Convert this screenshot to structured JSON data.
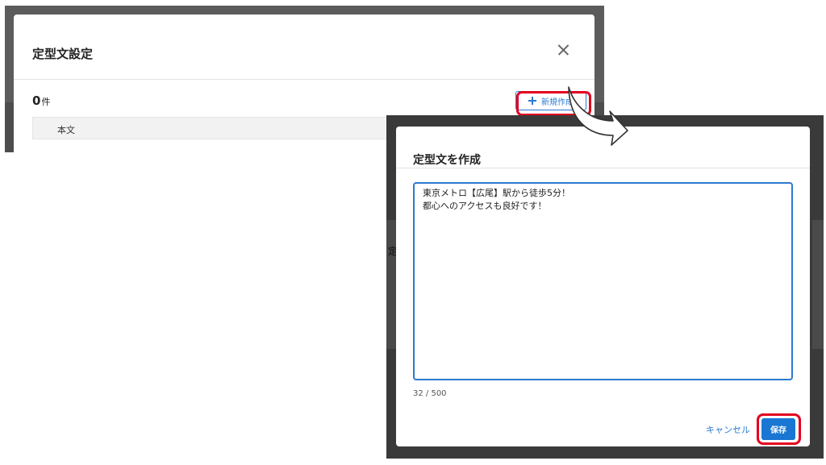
{
  "settings_dialog": {
    "title": "定型文設定",
    "count": "0",
    "count_unit": "件",
    "new_button_label": "新規作成",
    "table_header": {
      "column_body": "本文"
    }
  },
  "create_dialog": {
    "title": "定型文を作成",
    "textarea_value": "東京メトロ【広尾】駅から徒歩5分！\n都心へのアクセスも良好です！",
    "char_counter": "32 / 500",
    "cancel_label": "キャンセル",
    "save_label": "保存"
  },
  "background_fragment": "定",
  "icons": [
    "close-icon",
    "plus-icon",
    "arrow-icon"
  ],
  "colors": {
    "accent": "#1976d2",
    "highlight": "#e3001e",
    "overlay": "#5c5c5c"
  }
}
